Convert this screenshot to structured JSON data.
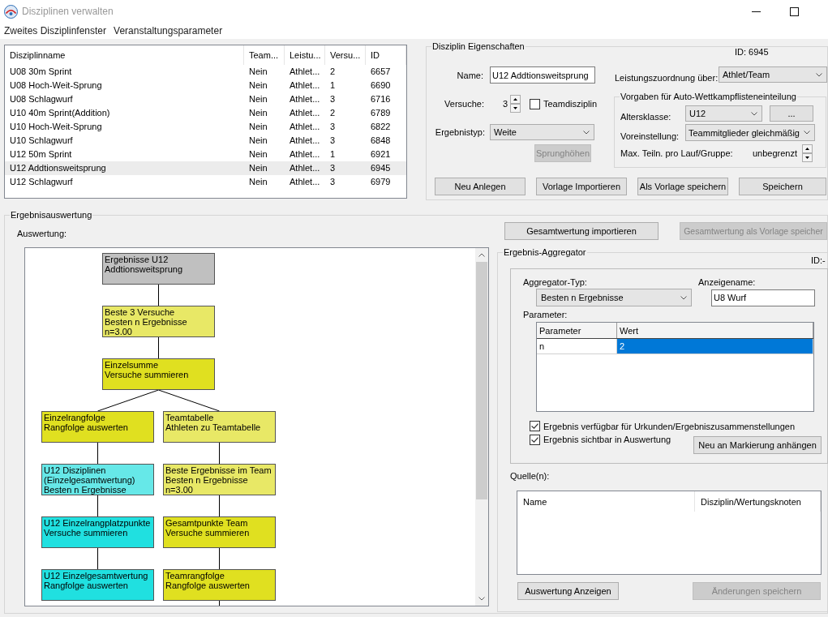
{
  "window": {
    "title": "Disziplinen verwalten"
  },
  "menu": [
    "Zweites Disziplinfenster",
    "Veranstaltungsparameter"
  ],
  "discipline_list": {
    "columns": [
      "Disziplinname",
      "Team...",
      "Leistu...",
      "Versu...",
      "ID"
    ],
    "rows": [
      {
        "cells": [
          "U08 30m Sprint",
          "Nein",
          "Athlet...",
          "2",
          "6657"
        ],
        "selected": false
      },
      {
        "cells": [
          "U08 Hoch-Weit-Sprung",
          "Nein",
          "Athlet...",
          "1",
          "6690"
        ],
        "selected": false
      },
      {
        "cells": [
          "U08 Schlagwurf",
          "Nein",
          "Athlet...",
          "3",
          "6716"
        ],
        "selected": false
      },
      {
        "cells": [
          "U10 40m Sprint(Addition)",
          "Nein",
          "Athlet...",
          "2",
          "6789"
        ],
        "selected": false
      },
      {
        "cells": [
          "U10 Hoch-Weit-Sprung",
          "Nein",
          "Athlet...",
          "3",
          "6822"
        ],
        "selected": false
      },
      {
        "cells": [
          "U10 Schlagwurf",
          "Nein",
          "Athlet...",
          "3",
          "6848"
        ],
        "selected": false
      },
      {
        "cells": [
          "U12 50m Sprint",
          "Nein",
          "Athlet...",
          "1",
          "6921"
        ],
        "selected": false
      },
      {
        "cells": [
          "U12 Addtionsweitsprung",
          "Nein",
          "Athlet...",
          "3",
          "6945"
        ],
        "selected": true
      },
      {
        "cells": [
          "U12 Schlagwurf",
          "Nein",
          "Athlet...",
          "3",
          "6979"
        ],
        "selected": false
      }
    ]
  },
  "properties": {
    "title": "Disziplin Eigenschaften",
    "id_label": "ID: 6945",
    "name_label": "Name:",
    "name_value": "U12 Addtionsweitsprung",
    "attempts_label": "Versuche:",
    "attempts_value": "3",
    "team_discipline": {
      "label": "Teamdisziplin",
      "checked": false
    },
    "result_type_label": "Ergebnistyp:",
    "result_type_value": "Weite",
    "jump_heights_button": {
      "label": "Sprunghöhen",
      "disabled": true
    },
    "assignment_label": "Leistungszuordnung über:",
    "assignment_value": "Athlet/Team",
    "defaults": {
      "title": "Vorgaben für Auto-Wettkampflisteneinteilung",
      "age_class_label": "Altersklasse:",
      "age_class_value": "U12",
      "more_button": {
        "label": "...",
        "disabled": false
      },
      "preset_label": "Voreinstellung:",
      "preset_value": "Teammitglieder gleichmäßig",
      "max_label": "Max. Teiln. pro Lauf/Gruppe:",
      "max_value": "unbegrenzt"
    },
    "buttons": [
      {
        "label": "Neu Anlegen",
        "disabled": false
      },
      {
        "label": "Vorlage Importieren",
        "disabled": false
      },
      {
        "label": "Als Vorlage speichern",
        "disabled": false
      },
      {
        "label": "Speichern",
        "disabled": false
      }
    ]
  },
  "evaluation": {
    "title": "Ergebnisauswertung",
    "label": "Auswertung:",
    "buttons": [
      {
        "label": "Gesamtwertung importieren",
        "disabled": false
      },
      {
        "label": "Gesamtwertung als Vorlage speicher",
        "disabled": true
      }
    ],
    "tree": {
      "lines": [
        "Ergebnisse U12",
        "Addtionsweitsprung"
      ],
      "color": "#c0c0c0",
      "more_below": false,
      "children": [
        {
          "lines": [
            "Beste 3 Versuche",
            "Besten n Ergebnisse",
            "n=3.00"
          ],
          "color": "#e8e866",
          "more_below": false,
          "children": [
            {
              "lines": [
                "Einzelsumme",
                "Versuche summieren"
              ],
              "color": "#e0e020",
              "more_below": false,
              "children": [
                {
                  "lines": [
                    "Einzelrangfolge",
                    "Rangfolge auswerten"
                  ],
                  "color": "#e0e020",
                  "more_below": false,
                  "children": [
                    {
                      "lines": [
                        "U12 Disziplinen",
                        "(Einzelgesamtwertung)",
                        "Besten n Ergebnisse"
                      ],
                      "color": "#66e8e8",
                      "more_below": false,
                      "children": [
                        {
                          "lines": [
                            "U12 Einzelrangplatzpunkte",
                            "Versuche summieren"
                          ],
                          "color": "#20e0e0",
                          "more_below": false,
                          "children": [
                            {
                              "lines": [
                                "U12 Einzelgesamtwertung",
                                "Rangfolge auswerten"
                              ],
                              "color": "#20e0e0",
                              "more_below": false
                            }
                          ]
                        }
                      ]
                    }
                  ]
                },
                {
                  "lines": [
                    "Teamtabelle",
                    "Athleten zu Teamtabelle"
                  ],
                  "color": "#e8e866",
                  "more_below": false,
                  "children": [
                    {
                      "lines": [
                        "Beste Ergebnisse im Team",
                        "Besten n Ergebnisse",
                        "n=3.00"
                      ],
                      "color": "#e8e866",
                      "more_below": false,
                      "children": [
                        {
                          "lines": [
                            "Gesamtpunkte Team",
                            "Versuche summieren"
                          ],
                          "color": "#e0e020",
                          "more_below": false,
                          "children": [
                            {
                              "lines": [
                                "Teamrangfolge",
                                "Rangfolge auswerten"
                              ],
                              "color": "#e0e020",
                              "more_below": true
                            }
                          ]
                        }
                      ]
                    }
                  ]
                }
              ]
            }
          ]
        }
      ]
    }
  },
  "aggregator": {
    "title": "Ergebnis-Aggregator",
    "id_label": "ID:-",
    "type_label": "Aggregator-Typ:",
    "type_value": "Besten n Ergebnisse",
    "display_name_label": "Anzeigename:",
    "display_name_value": "U8 Wurf",
    "parameters_label": "Parameter:",
    "parameters": {
      "columns": [
        "Parameter",
        "Wert"
      ],
      "rows": [
        {
          "cells": [
            {
              "text": "n",
              "selected": false
            },
            {
              "text": "2",
              "selected": true
            }
          ]
        }
      ]
    },
    "checkboxes": [
      {
        "label": "Ergebnis verfügbar für Urkunden/Ergebniszusammenstellungen",
        "checked": true
      },
      {
        "label": "Ergebnis sichtbar in Auswertung",
        "checked": true
      }
    ],
    "attach_button": {
      "label": "Neu an Markierung anhängen",
      "disabled": false
    },
    "sources_label": "Quelle(n):",
    "sources": {
      "columns": [
        "Name",
        "Disziplin/Wertungsknoten"
      ]
    },
    "buttons": [
      {
        "label": "Auswertung Anzeigen",
        "disabled": false
      },
      {
        "label": "Änderungen speichern",
        "disabled": true
      }
    ]
  }
}
